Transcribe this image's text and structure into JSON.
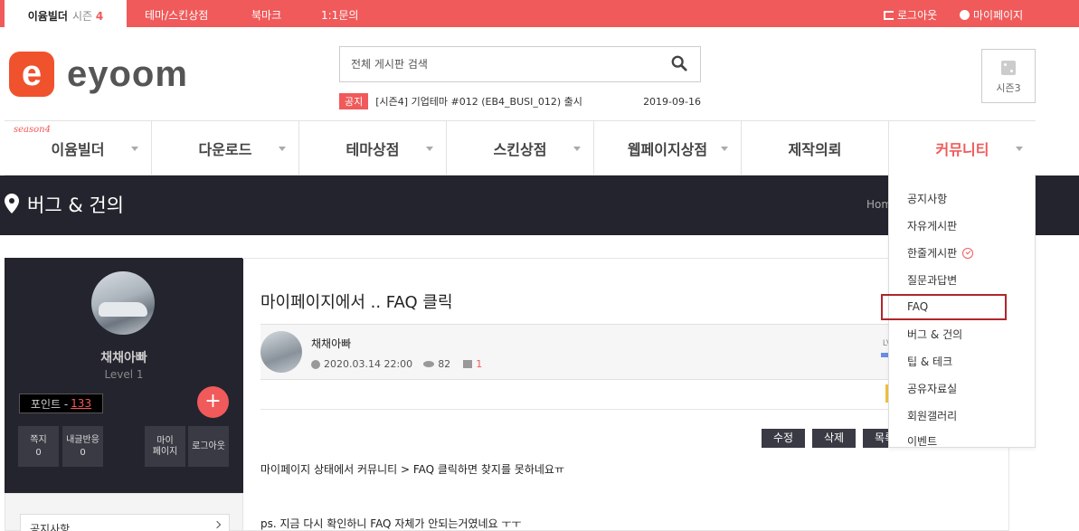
{
  "topbar": {
    "brand": "이윰빌더",
    "season_label": "시즌",
    "season_num": "4",
    "links": [
      "테마/스킨상점",
      "북마크",
      "1:1문의"
    ],
    "logout": "로그아웃",
    "mypage": "마이페이지"
  },
  "header": {
    "logo_mark": "e",
    "logo_text": "eyoom",
    "search_placeholder": "전체 게시판 검색",
    "notice_tag": "공지",
    "notice_text": "[시즌4] 기업테마 #012 (EB4_BUSI_012) 출시",
    "notice_date": "2019-09-16",
    "season_box_label": "시즌3"
  },
  "nav": {
    "season_badge": "season4",
    "items": [
      "이윰빌더",
      "다운로드",
      "테마상점",
      "스킨상점",
      "웹페이지상점",
      "제작의뢰",
      "커뮤니티"
    ]
  },
  "band": {
    "title": "버그 & 건의",
    "crumb": "Home"
  },
  "sidebar": {
    "name": "채채아빠",
    "level": "Level 1",
    "point_label": "포인트 -",
    "point_value": "133",
    "plus": "+",
    "stats": [
      {
        "label": "쪽지",
        "value": "0"
      },
      {
        "label": "내글반응",
        "value": "0"
      }
    ],
    "mypage_btn": "마이\n페이지",
    "logout_btn": "로그아웃",
    "menu_first": "공지사항"
  },
  "post": {
    "title": "마이페이지에서 .. FAQ 클릭",
    "writer": "채채아빠",
    "datetime": "2020.03.14 22:00",
    "views": "82",
    "comments": "1",
    "lv": "LV",
    "actions": [
      "수정",
      "삭제",
      "목록"
    ],
    "body1": "마이페이지 상태에서 커뮤니티 > FAQ 클릭하면 찾지를 못하네요ㅠ",
    "body2": "ps. 지금 다시 확인하니 FAQ 자체가 안되는거였네요 ㅜㅜ"
  },
  "dropdown": {
    "items": [
      "공지사항",
      "자유게시판",
      "한줄게시판",
      "질문과답변",
      "FAQ",
      "버그 & 건의",
      "팁 & 테크",
      "공유자료실",
      "회원갤러리",
      "이벤트"
    ]
  },
  "colors": {
    "accent": "#f05a5a",
    "dark": "#24242e",
    "highlight_box": "#b0262a"
  }
}
